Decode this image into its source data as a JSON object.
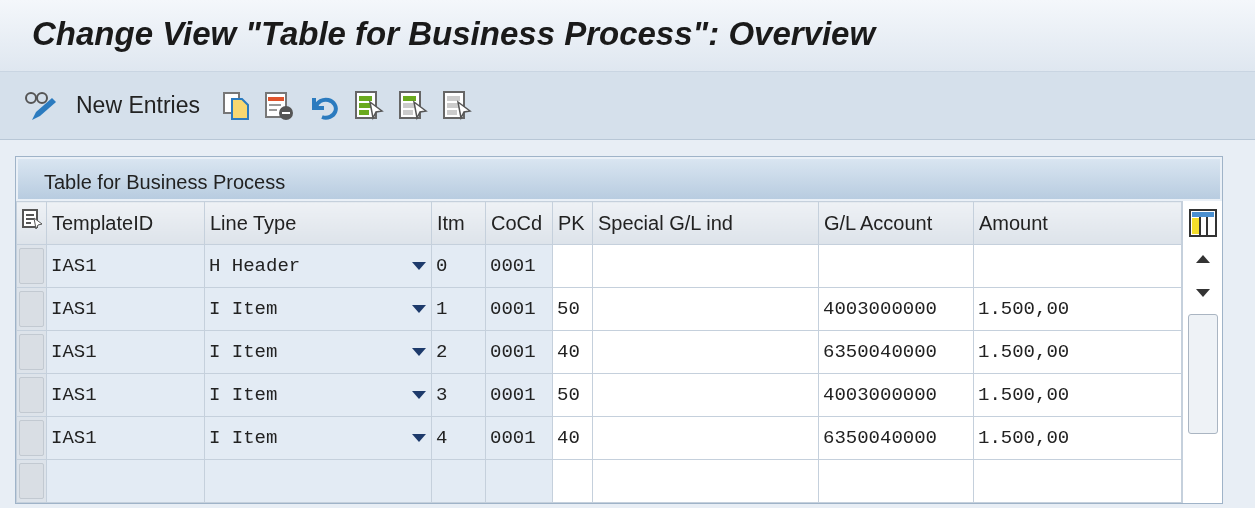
{
  "window": {
    "title": "Change View \"Table for Business Process\": Overview"
  },
  "toolbar": {
    "new_entries": "New Entries"
  },
  "table": {
    "title": "Table for Business Process",
    "columns": [
      {
        "label": "TemplateID",
        "kind": "text",
        "editable": false
      },
      {
        "label": "Line Type",
        "kind": "dropdown",
        "editable": false
      },
      {
        "label": "Itm",
        "kind": "text",
        "editable": false
      },
      {
        "label": "CoCd",
        "kind": "text",
        "editable": false
      },
      {
        "label": "PK",
        "kind": "text",
        "editable": true
      },
      {
        "label": "Special G/L ind",
        "kind": "text",
        "editable": true
      },
      {
        "label": "G/L Account",
        "kind": "text",
        "editable": true
      },
      {
        "label": "Amount",
        "kind": "text",
        "editable": true
      }
    ],
    "rows": [
      {
        "cells": [
          "IAS1",
          "H Header",
          "0",
          "0001",
          null,
          null,
          null,
          null
        ]
      },
      {
        "cells": [
          "IAS1",
          "I Item",
          "1",
          "0001",
          "50",
          null,
          "4003000000",
          "1.500,00"
        ]
      },
      {
        "cells": [
          "IAS1",
          "I Item",
          "2",
          "0001",
          "40",
          null,
          "6350040000",
          "1.500,00"
        ]
      },
      {
        "cells": [
          "IAS1",
          "I Item",
          "3",
          "0001",
          "50",
          null,
          "4003000000",
          "1.500,00"
        ]
      },
      {
        "cells": [
          "IAS1",
          "I Item",
          "4",
          "0001",
          "40",
          null,
          "6350040000",
          "1.500,00"
        ]
      }
    ]
  }
}
